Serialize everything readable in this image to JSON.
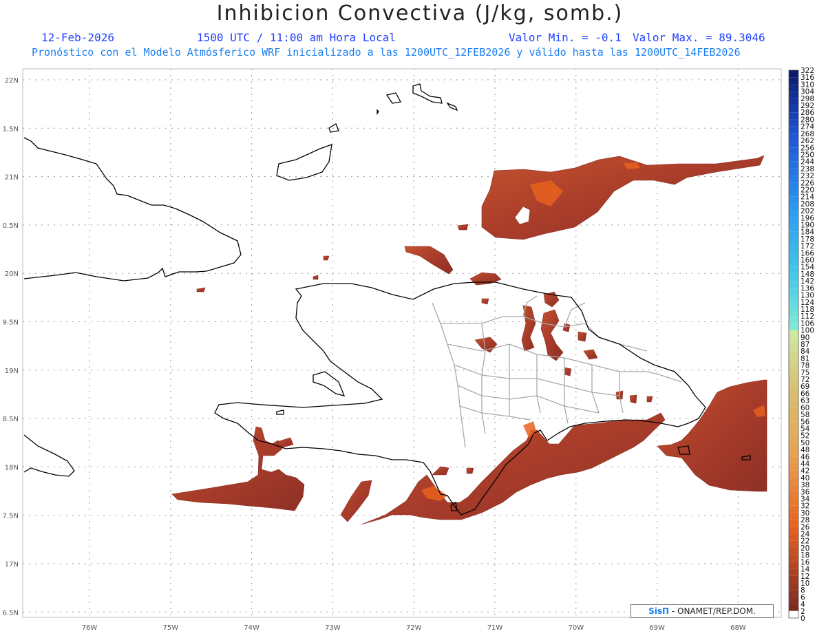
{
  "header": {
    "title": "Inhibicion Convectiva (J/kg, somb.)",
    "date": "12-Feb-2026",
    "time": "1500 UTC / 11:00 am Hora Local",
    "min_label": "Valor Min. = -0.1",
    "max_label": "Valor Max. = 89.3046",
    "description": "Pronóstico con el Modelo Atmósferico WRF inicializado a las 1200UTC_12FEB2026 y válido hasta las  1200UTC_14FEB2026"
  },
  "map": {
    "lon_labels": [
      "76W",
      "75W",
      "74W",
      "73W",
      "72W",
      "71W",
      "70W",
      "69W",
      "68W"
    ],
    "lat_labels": [
      "22N",
      "1.5N",
      "21N",
      "0.5N",
      "20N",
      "9.5N",
      "19N",
      "8.5N",
      "18N",
      "7.5N",
      "17N",
      "6.5N"
    ],
    "shading_color": "#b8452a",
    "coast_color": "#000000",
    "border_color": "#a8a8a8"
  },
  "colorbar": {
    "ticks": [
      "322",
      "316",
      "310",
      "304",
      "298",
      "292",
      "286",
      "280",
      "274",
      "268",
      "262",
      "256",
      "250",
      "244",
      "238",
      "232",
      "226",
      "220",
      "214",
      "208",
      "202",
      "196",
      "190",
      "184",
      "178",
      "172",
      "166",
      "160",
      "154",
      "148",
      "142",
      "136",
      "130",
      "124",
      "118",
      "112",
      "106",
      "100",
      "90",
      "87",
      "84",
      "81",
      "78",
      "75",
      "72",
      "69",
      "66",
      "63",
      "60",
      "58",
      "56",
      "54",
      "52",
      "50",
      "48",
      "46",
      "44",
      "42",
      "40",
      "38",
      "36",
      "34",
      "32",
      "30",
      "28",
      "26",
      "24",
      "22",
      "20",
      "18",
      "16",
      "14",
      "12",
      "10",
      "8",
      "6",
      "4",
      "2",
      "0"
    ]
  },
  "credit": {
    "logo": "SisΠ",
    "org": " - ONAMET/REP.DOM."
  }
}
